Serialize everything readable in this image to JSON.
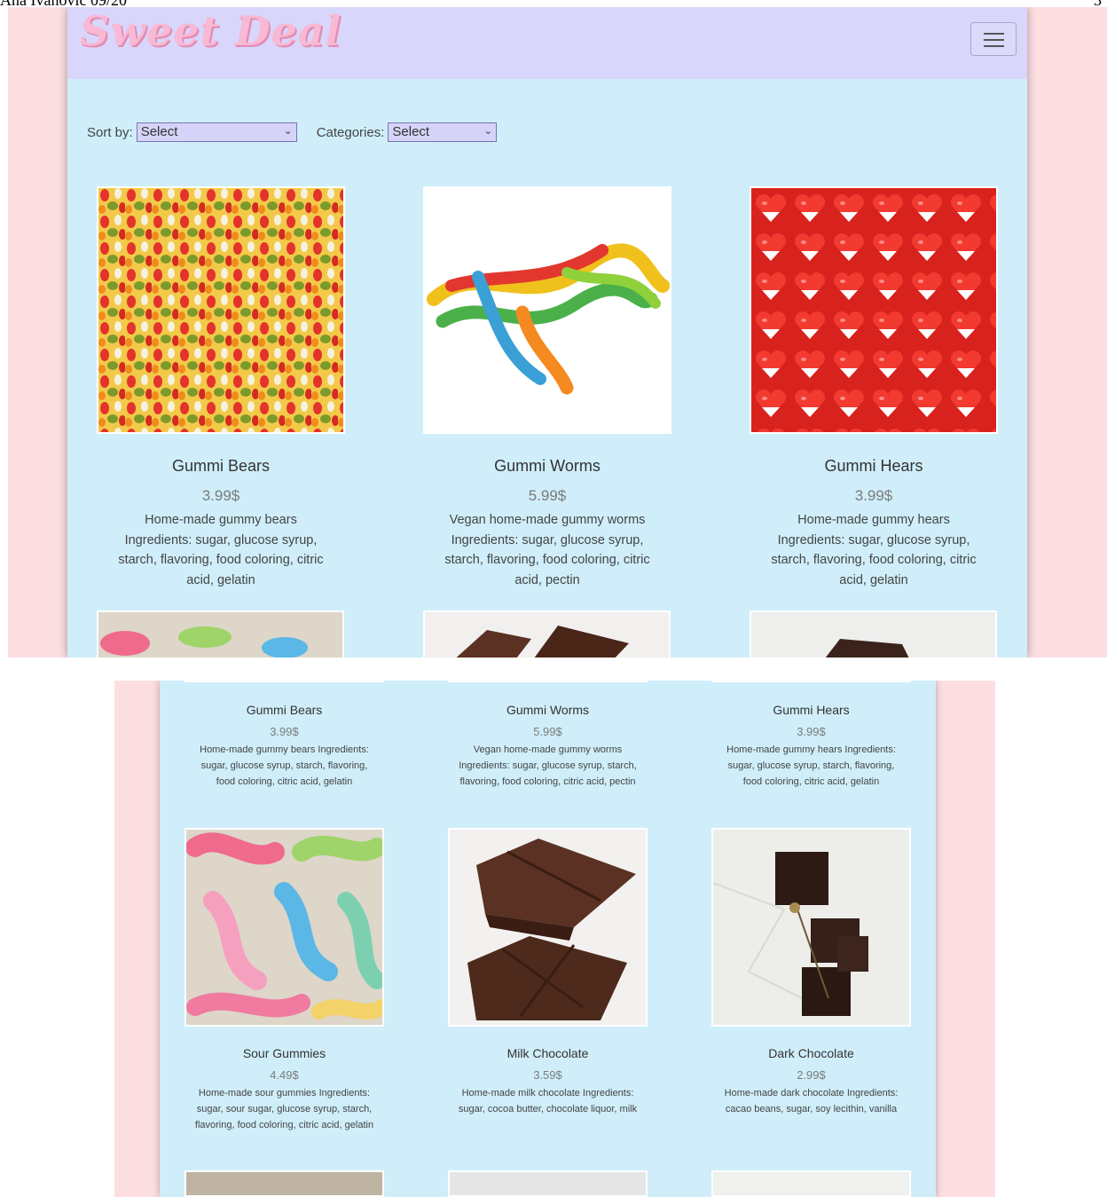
{
  "doc": {
    "author": "Ana Ivanović 09/20",
    "page_number": "3"
  },
  "app": {
    "logo": "Sweet Deal",
    "menu_icon": "hamburger-icon"
  },
  "filters": {
    "sort_label": "Sort by:",
    "sort_value": "Select",
    "categories_label": "Categories:",
    "categories_value": "Select"
  },
  "colors": {
    "navbar": "#d8d6fb",
    "page_bg": "#cfeefa",
    "outer_bg": "#fddfe2",
    "logo": "#f8b9d4"
  },
  "products": [
    {
      "name": "Gummi Bears",
      "price": "3.99$",
      "desc": "Home-made gummy bears Ingredients: sugar, glucose syrup, starch, flavoring, food coloring, citric acid, gelatin"
    },
    {
      "name": "Gummi Worms",
      "price": "5.99$",
      "desc": "Vegan home-made gummy worms Ingredients: sugar, glucose syrup, starch, flavoring, food coloring, citric acid, pectin"
    },
    {
      "name": "Gummi Hears",
      "price": "3.99$",
      "desc": "Home-made gummy hears Ingredients: sugar, glucose syrup, starch, flavoring, food coloring, citric acid, gelatin"
    },
    {
      "name": "Sour Gummies",
      "price": "4.49$",
      "desc": "Home-made sour gummies Ingredients: sugar, sour sugar, glucose syrup, starch, flavoring, food coloring, citric acid, gelatin"
    },
    {
      "name": "Milk Chocolate",
      "price": "3.59$",
      "desc": "Home-made milk chocolate Ingredients: sugar, cocoa butter, chocolate liquor, milk"
    },
    {
      "name": "Dark Chocolate",
      "price": "2.99$",
      "desc": "Home-made dark chocolate Ingredients: cacao beans, sugar, soy lecithin, vanilla"
    }
  ]
}
